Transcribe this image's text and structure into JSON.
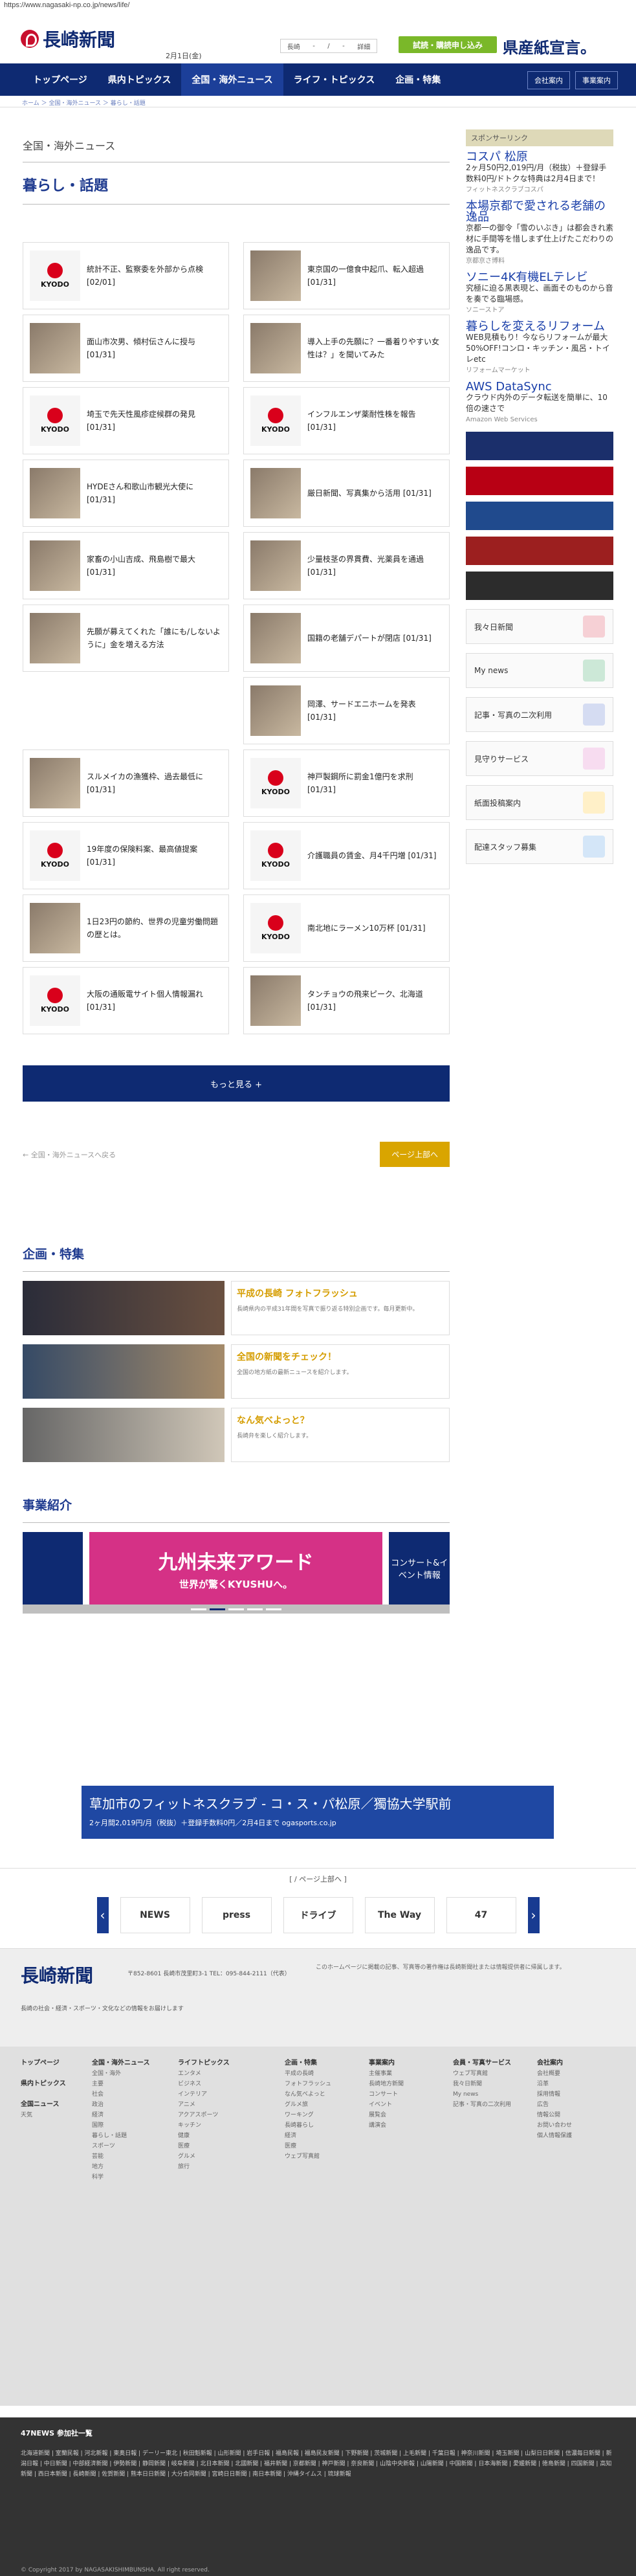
{
  "url": "https://www.nagasaki-np.co.jp/news/life/",
  "logo_text": "長崎新聞",
  "date": "2月1日(金)",
  "weather": [
    "長崎",
    "-",
    "/",
    "-",
    "詳細"
  ],
  "trial": "試読・購読申し込み",
  "kenpan": "県産紙宣言。",
  "nav": [
    "トップページ",
    "県内トピックス",
    "全国・海外ニュース",
    "ライフ・トピックス",
    "企画・特集"
  ],
  "nav_right": [
    "会社案内",
    "事業案内"
  ],
  "breadcrumb": "ホーム ＞ 全国・海外ニュース ＞ 暮らし・話題",
  "section": "全国・海外ニュース",
  "topic": "暮らし・話題",
  "cards": [
    {
      "title": "統計不正、監察委を外部から点検 [02/01]",
      "kind": "kyodo"
    },
    {
      "title": "東京国の一億食中起爪、転入超過 [01/31]",
      "kind": "photo"
    },
    {
      "title": "面山市次男、傾村伝さんに授与 [01/31]",
      "kind": "photo"
    },
    {
      "title": "導入上手の先願に？一番着りやすい女性は？」を聞いてみた",
      "kind": "photo"
    },
    {
      "title": "埼玉で先天性風疹症候群の発見 [01/31]",
      "kind": "kyodo"
    },
    {
      "title": "インフルエンザ薬耐性株を報告 [01/31]",
      "kind": "kyodo"
    },
    {
      "title": "HYDEさん和歌山市観光大使に [01/31]",
      "kind": "photo"
    },
    {
      "title": "厳日新聞、写真集から活用 [01/31]",
      "kind": "photo"
    },
    {
      "title": "家畜の小山吉成、飛島樹で最大 [01/31]",
      "kind": "photo"
    },
    {
      "title": "少量枝茎の界貫費、光薬員を通過 [01/31]",
      "kind": "photo"
    },
    {
      "title": "先願が募えてくれた「誰にも/しないように」金を増える方法",
      "kind": "photo"
    },
    {
      "title": "国籍の老舗デパートが閉店 [01/31]",
      "kind": "photo"
    },
    {
      "title": "",
      "kind": "none"
    },
    {
      "title": "岡澤、サードエニホームを発表 [01/31]",
      "kind": "photo"
    },
    {
      "title": "スルメイカの漁獲枠、過去最低に [01/31]",
      "kind": "photo"
    },
    {
      "title": "神戸製鋼所に罰金1億円を求刑 [01/31]",
      "kind": "kyodo"
    },
    {
      "title": "19年度の保険料案、最高値提案 [01/31]",
      "kind": "kyodo"
    },
    {
      "title": "介護職員の賃金、月4千円増 [01/31]",
      "kind": "kyodo"
    },
    {
      "title": "1日23円の節約、世界の児童労働問題の歴とは。",
      "kind": "photo"
    },
    {
      "title": "南北地にラーメン10万杯 [01/31]",
      "kind": "kyodo"
    },
    {
      "title": "大阪の通販電サイト個人情報漏れ [01/31]",
      "kind": "kyodo"
    },
    {
      "title": "タンチョウの飛来ピーク、北海道 [01/31]",
      "kind": "photo"
    }
  ],
  "more": "もっと見る +",
  "back_link": "← 全国・海外ニュースへ戻る",
  "pagetop": "ページ上部へ",
  "feature_title": "企画・特集",
  "features": [
    {
      "title": "平成の長崎 フォトフラッシュ",
      "desc": "長崎県内の平成31年間を写真で振り返る特別企画です。毎月更新中。"
    },
    {
      "title": "全国の新聞をチェック！",
      "desc": "全国の地方紙の最新ニュースを紹介します。"
    },
    {
      "title": "なん気べよっと？",
      "desc": "長崎弁を楽しく紹介します。"
    }
  ],
  "business_title": "事業紹介",
  "banner_center": "九州未来アワード",
  "banner_sub": "世界が驚くKYUSHUへ。",
  "banner_right": "コンサート&イベント情報",
  "sponsor": "スポンサーリンク",
  "ads": [
    {
      "head": "コスパ 松原",
      "body": "2ヶ月50円2,019円/月（税抜）＋登録手数料0円/ドトクな特典は2月4日まで！",
      "src": "フィットネスクラブコスパ"
    },
    {
      "head": "本場京都で愛される老舗の逸品",
      "body": "京都一の御令「雪のいぶき」は都会きれ素材に手間等を惜しまず仕上げたこだわりの逸品です。",
      "src": "京都京さ博料"
    },
    {
      "head": "ソニー4K有機ELテレビ",
      "body": "究極に迫る黒表現と、画面そのものから音を奏でる臨場感。",
      "src": "ソニーストア"
    },
    {
      "head": "暮らしを変えるリフォーム",
      "body": "WEB見積もり！今ならリフォームが最大50%OFF!コンロ・キッチン・風呂・トイレetc",
      "src": "リフォームマーケット"
    },
    {
      "head": "AWS DataSync",
      "body": "クラウド内外のデータ転送を簡単に、10 倍の速さで",
      "src": "Amazon Web Services"
    }
  ],
  "side_links": [
    "我々日新聞",
    "My news",
    "記事・写真の二次利用",
    "見守りサービス",
    "紙面投稿案内",
    "配達スタッフ募集"
  ],
  "ticker_ad": "草加市のフィットネスクラブ - コ・ス・パ松原／獨協大学駅前",
  "ticker_sub": "2ヶ月間2,019円/月（税抜）＋登録手数料0円／2月4日まで ogasports.co.jp",
  "carousel_title": "[ / ページ上部へ ]",
  "carousel_items": [
    "NEWS",
    "press",
    "ドライブ",
    "The Way",
    "47"
  ],
  "footer_addr": "〒852-8601 長崎市茂里町3-1 TEL：095-844-2111（代表）",
  "footer_note": "長崎の社会・経済・スポーツ・文化などの情報をお届けします",
  "footer_right": "このホームページに掲載の記事、写真等の著作権は長崎新聞社または情報提供者に帰属します。",
  "bottom_title": "47NEWS 参加社一覧",
  "copyright": "© Copyright 2017 by NAGASAKISHIMBUNSHA. All right reserved."
}
